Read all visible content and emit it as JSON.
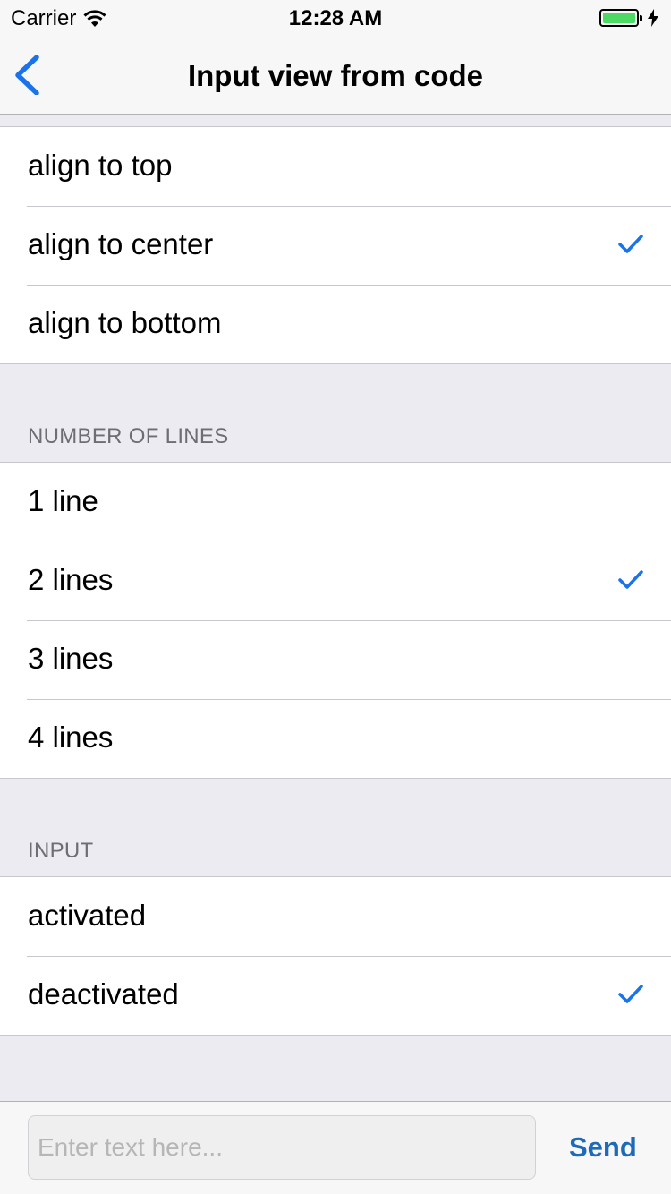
{
  "status_bar": {
    "carrier": "Carrier",
    "time": "12:28 AM"
  },
  "nav": {
    "title": "Input view from code",
    "back_icon": "chevron-left-icon"
  },
  "alignment_section": {
    "rows": [
      {
        "label": "align to top",
        "checked": false
      },
      {
        "label": "align to center",
        "checked": true
      },
      {
        "label": "align to bottom",
        "checked": false
      }
    ]
  },
  "lines_section": {
    "header": "NUMBER OF LINES",
    "rows": [
      {
        "label": "1 line",
        "checked": false
      },
      {
        "label": "2 lines",
        "checked": true
      },
      {
        "label": "3 lines",
        "checked": false
      },
      {
        "label": "4 lines",
        "checked": false
      }
    ]
  },
  "input_section": {
    "header": "INPUT",
    "rows": [
      {
        "label": "activated",
        "checked": false
      },
      {
        "label": "deactivated",
        "checked": true
      }
    ]
  },
  "input_bar": {
    "value": "",
    "placeholder": "Enter text here...",
    "send_label": "Send"
  },
  "colors": {
    "accent": "#1a73e8",
    "battery": "#4cd964",
    "send": "#1d6bb8"
  }
}
